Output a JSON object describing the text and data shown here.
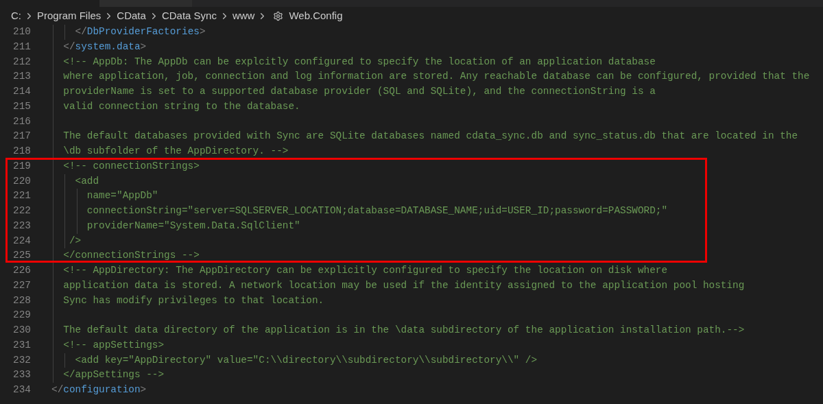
{
  "tabs": [
    {
      "selected": true
    },
    {
      "selected": false
    }
  ],
  "breadcrumb": [
    {
      "label": "C:",
      "kind": "folder"
    },
    {
      "label": "Program Files",
      "kind": "folder"
    },
    {
      "label": "CData",
      "kind": "folder"
    },
    {
      "label": "CData Sync",
      "kind": "folder"
    },
    {
      "label": "www",
      "kind": "folder"
    },
    {
      "label": "Web.Config",
      "kind": "settings-file"
    }
  ],
  "lines": [
    {
      "number": "210",
      "segments": [
        {
          "text": "    </",
          "kind": "punct"
        },
        {
          "text": "DbProviderFactories",
          "kind": "tag"
        },
        {
          "text": ">",
          "kind": "punct"
        }
      ]
    },
    {
      "number": "211",
      "segments": [
        {
          "text": "  </",
          "kind": "punct"
        },
        {
          "text": "system.data",
          "kind": "tag"
        },
        {
          "text": ">",
          "kind": "punct"
        }
      ]
    },
    {
      "number": "212",
      "segments": [
        {
          "text": "  <!-- AppDb: The AppDb can be explcitly configured to specify the location of an application database",
          "kind": "comment"
        }
      ]
    },
    {
      "number": "213",
      "segments": [
        {
          "text": "  where application, job, connection and log information are stored. Any reachable database can be configured, provided that the",
          "kind": "comment"
        }
      ]
    },
    {
      "number": "214",
      "segments": [
        {
          "text": "  providerName is set to a supported database provider (SQL and SQLite), and the connectionString is a",
          "kind": "comment"
        }
      ]
    },
    {
      "number": "215",
      "segments": [
        {
          "text": "  valid connection string to the database.",
          "kind": "comment"
        }
      ]
    },
    {
      "number": "216"
    },
    {
      "number": "217",
      "segments": [
        {
          "text": "  The default databases provided with Sync are SQLite databases named cdata_sync.db and sync_status.db that are located in the",
          "kind": "comment"
        }
      ]
    },
    {
      "number": "218",
      "segments": [
        {
          "text": "  \\db subfolder of the AppDirectory. -->",
          "kind": "comment"
        }
      ]
    },
    {
      "number": "219",
      "segments": [
        {
          "text": "  <!-- connectionStrings>",
          "kind": "comment"
        }
      ]
    },
    {
      "number": "220",
      "segments": [
        {
          "text": "    <add",
          "kind": "comment"
        }
      ]
    },
    {
      "number": "221",
      "segments": [
        {
          "text": "      name=\"AppDb\"",
          "kind": "comment"
        }
      ]
    },
    {
      "number": "222",
      "segments": [
        {
          "text": "      connectionString=\"server=SQLSERVER_LOCATION;database=DATABASE_NAME;uid=USER_ID;password=PASSWORD;\"",
          "kind": "comment"
        }
      ]
    },
    {
      "number": "223",
      "segments": [
        {
          "text": "      providerName=\"System.Data.SqlClient\"",
          "kind": "comment"
        }
      ]
    },
    {
      "number": "224",
      "segments": [
        {
          "text": "   />",
          "kind": "comment"
        }
      ]
    },
    {
      "number": "225",
      "segments": [
        {
          "text": "  </connectionStrings -->",
          "kind": "comment"
        }
      ]
    },
    {
      "number": "226",
      "segments": [
        {
          "text": "  <!-- AppDirectory: The AppDirectory can be explicitly configured to specify the location on disk where",
          "kind": "comment"
        }
      ]
    },
    {
      "number": "227",
      "segments": [
        {
          "text": "  application data is stored. A network location may be used if the identity assigned to the application pool hosting",
          "kind": "comment"
        }
      ]
    },
    {
      "number": "228",
      "segments": [
        {
          "text": "  Sync has modify privileges to that location.",
          "kind": "comment"
        }
      ]
    },
    {
      "number": "229"
    },
    {
      "number": "230",
      "segments": [
        {
          "text": "  The default data directory of the application is in the \\data subdirectory of the application installation path.-->",
          "kind": "comment"
        }
      ]
    },
    {
      "number": "231",
      "segments": [
        {
          "text": "  <!-- appSettings>",
          "kind": "comment"
        }
      ]
    },
    {
      "number": "232",
      "segments": [
        {
          "text": "    <add key=\"AppDirectory\" value=\"C:\\\\directory\\\\subdirectory\\\\subdirectory\\\\\" />",
          "kind": "comment"
        }
      ]
    },
    {
      "number": "233",
      "segments": [
        {
          "text": "  </appSettings -->",
          "kind": "comment"
        }
      ]
    },
    {
      "number": "234",
      "segments": [
        {
          "text": "</",
          "kind": "punct"
        },
        {
          "text": "configuration",
          "kind": "tag"
        },
        {
          "text": ">",
          "kind": "punct"
        }
      ]
    }
  ]
}
